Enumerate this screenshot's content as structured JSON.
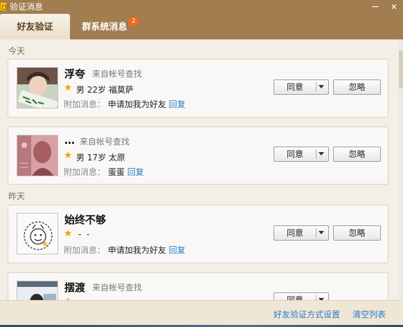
{
  "window": {
    "title": "验证消息",
    "minimize": "−",
    "close": "✕"
  },
  "tabs": [
    {
      "label": "好友验证"
    },
    {
      "label": "群系统消息",
      "badge": "2"
    }
  ],
  "sections": {
    "today": "今天",
    "yesterday": "昨天"
  },
  "requests": [
    {
      "name": "浮夸",
      "source": "来自帐号查找",
      "gender_age": "男 22岁",
      "location": "福莫萨",
      "extra_label": "附加消息：",
      "message": "申请加我为好友",
      "reply": "回复",
      "agree": "同意",
      "ignore": "忽略",
      "avatar_icon": "avatar-photo-icon"
    },
    {
      "name": "…",
      "source": "来自帐号查找",
      "gender_age": "男 17岁",
      "location": "太原",
      "extra_label": "附加消息：",
      "message": "蛋蛋",
      "reply": "回复",
      "agree": "同意",
      "ignore": "忽略",
      "avatar_icon": "avatar-banknote-icon"
    },
    {
      "name": "始终不够",
      "source": "",
      "gender_age": "-",
      "location": "-",
      "extra_label": "附加消息：",
      "message": "申请加我为好友",
      "reply": "回复",
      "agree": "同意",
      "ignore": "忽略",
      "avatar_icon": "avatar-drawing-icon"
    },
    {
      "name": "摆渡",
      "source": "来自帐号查找",
      "gender_age": "",
      "location": "",
      "extra_label": "",
      "message": "",
      "reply": "",
      "agree": "同意",
      "ignore": "",
      "avatar_icon": "avatar-photo-icon"
    }
  ],
  "footer": {
    "settings_link": "好友验证方式设置",
    "clear_link": "清空列表"
  }
}
